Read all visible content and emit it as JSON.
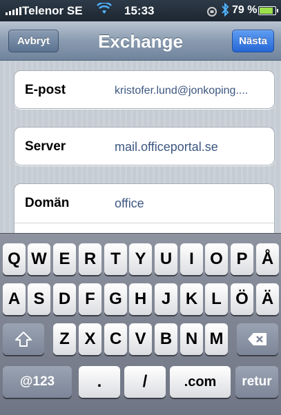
{
  "status_bar": {
    "carrier": "Telenor SE",
    "time": "15:33",
    "battery_percent": "79 %",
    "battery_level": 0.79,
    "icons": [
      "signal-icon",
      "wifi-icon",
      "lock-rotation-icon",
      "bluetooth-icon",
      "battery-icon"
    ]
  },
  "nav": {
    "title": "Exchange",
    "cancel_label": "Avbryt",
    "next_label": "Nästa"
  },
  "form": {
    "fields": [
      {
        "label": "E-post",
        "value": "kristofer.lund@jonkoping...."
      },
      {
        "label": "Server",
        "value": "mail.officeportal.se"
      },
      {
        "label": "Domän",
        "value": "office"
      }
    ]
  },
  "keyboard": {
    "row1": [
      "Q",
      "W",
      "E",
      "R",
      "T",
      "Y",
      "U",
      "I",
      "O",
      "P",
      "Å"
    ],
    "row2": [
      "A",
      "S",
      "D",
      "F",
      "G",
      "H",
      "J",
      "K",
      "L",
      "Ö",
      "Ä"
    ],
    "row3": [
      "Z",
      "X",
      "C",
      "V",
      "B",
      "N",
      "M"
    ],
    "row4": {
      "numbers": "@123",
      "dot": ".",
      "slash": "/",
      "dotcom": ".com",
      "return": "retur"
    }
  },
  "colors": {
    "nav_gradient_top": "#b9c4d2",
    "next_button": "#2767d6",
    "field_value_text": "#3c5680",
    "battery_fill": "#9be04b"
  }
}
